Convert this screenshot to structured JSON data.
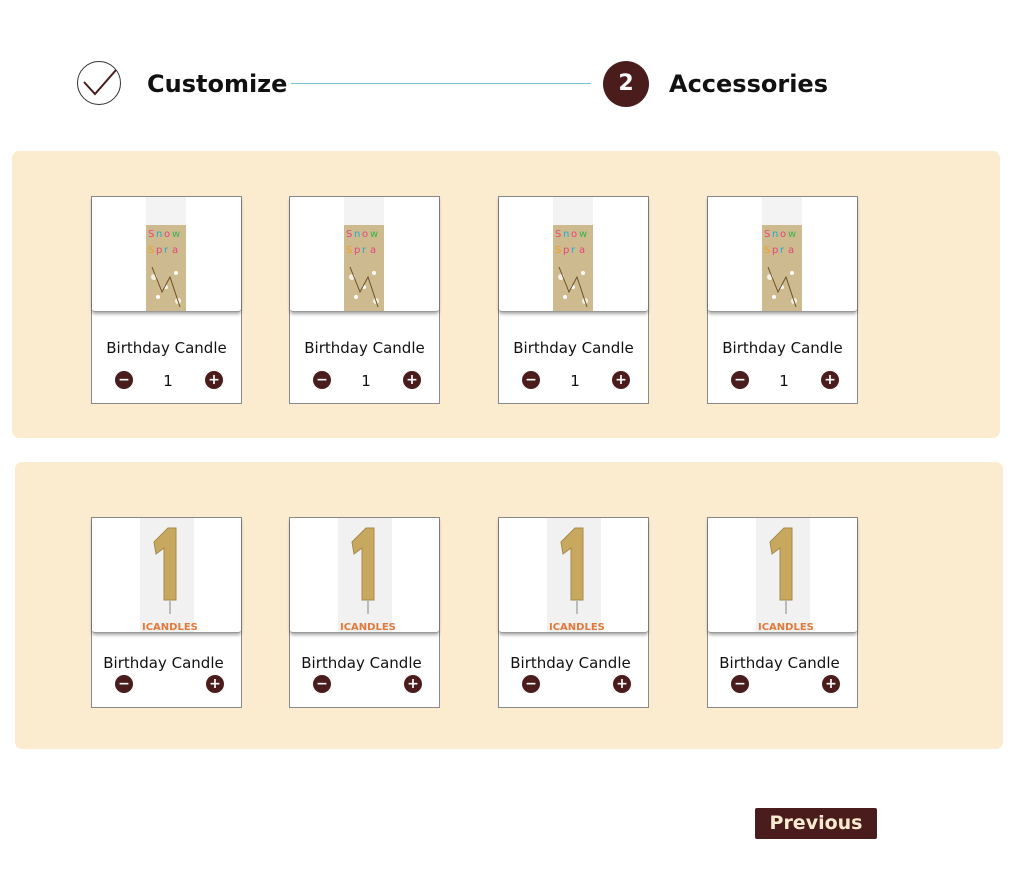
{
  "stepper": {
    "step1_label": "Customize",
    "step2_number": "2",
    "step2_label": "Accessories"
  },
  "colors": {
    "accent": "#4a1c1c",
    "panel_bg": "#fbecd0",
    "connector": "#6cc7d3"
  },
  "groups": [
    {
      "image": "snow-spray-candle-image",
      "items": [
        {
          "name": "Birthday Candle",
          "minus": "−",
          "quantity": "1",
          "plus": "+"
        },
        {
          "name": "Birthday Candle",
          "minus": "−",
          "quantity": "1",
          "plus": "+"
        },
        {
          "name": "Birthday Candle",
          "minus": "−",
          "quantity": "1",
          "plus": "+"
        },
        {
          "name": "Birthday Candle",
          "minus": "−",
          "quantity": "1",
          "plus": "+"
        }
      ]
    },
    {
      "image": "number-one-candle-image",
      "items": [
        {
          "name": "Birthday Candle",
          "minus": "−",
          "plus": "+"
        },
        {
          "name": "Birthday Candle",
          "minus": "−",
          "plus": "+"
        },
        {
          "name": "Birthday Candle",
          "minus": "−",
          "plus": "+"
        },
        {
          "name": "Birthday Candle",
          "minus": "−",
          "plus": "+"
        }
      ]
    }
  ],
  "footer": {
    "previous_label": "Previous"
  }
}
